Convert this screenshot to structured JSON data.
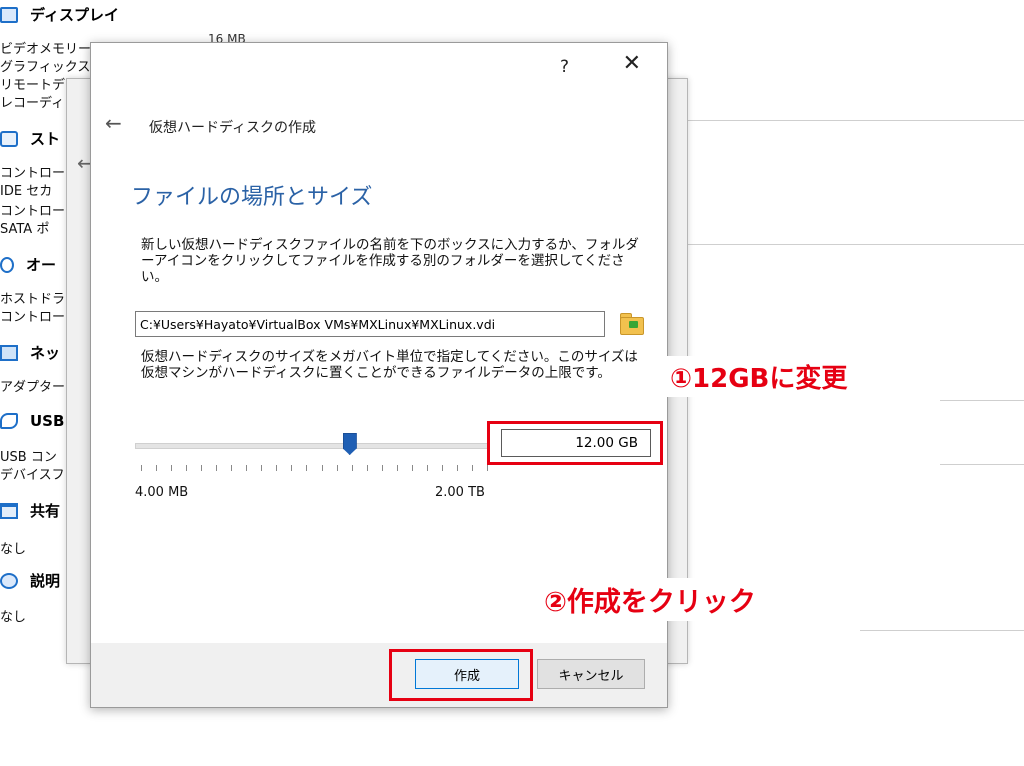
{
  "background": {
    "display_header": "ディスプレイ",
    "display_rows": [
      "ビデオメモリー",
      "グラフィックスコ",
      "リモートデスク",
      "レコーディ"
    ],
    "display_value": "16 MB",
    "storage_header": "スト",
    "storage_rows": [
      "コントロー",
      " IDE セカ",
      "コントロー",
      " SATA ポ"
    ],
    "audio_header": "オー",
    "audio_rows": [
      "ホストドラ",
      "コントロー"
    ],
    "network_header": "ネッ",
    "network_rows": [
      "アダプター"
    ],
    "usb_header": "USB",
    "usb_rows": [
      "USB コン",
      "デバイスフ"
    ],
    "shared_header": "共有",
    "shared_rows": [
      "なし"
    ],
    "description_header": "説明",
    "description_rows": [
      "なし"
    ]
  },
  "dialog": {
    "help_label": "?",
    "close_label": "✕",
    "back_label": "←",
    "wizard_title": "仮想ハードディスクの作成",
    "section_title": "ファイルの場所とサイズ",
    "location_description": "新しい仮想ハードディスクファイルの名前を下のボックスに入力するか、フォルダーアイコンをクリックしてファイルを作成する別のフォルダーを選択してください。",
    "file_path": "C:¥Users¥Hayato¥VirtualBox VMs¥MXLinux¥MXLinux.vdi",
    "size_description": "仮想ハードディスクのサイズをメガバイト単位で指定してください。このサイズは仮想マシンがハードディスクに置くことができるファイルデータの上限です。",
    "size_value": "12.00 GB",
    "slider_position": 0.61,
    "slider_min_label": "4.00 MB",
    "slider_max_label": "2.00 TB",
    "create_label": "作成",
    "cancel_label": "キャンセル"
  },
  "annotations": {
    "step1": "①12GBに変更",
    "step2": "②作成をクリック",
    "highlight_color": "#e60012"
  },
  "colors": {
    "section_title": "#2b62a6",
    "slider_thumb": "#1f5fb4",
    "primary_button_border": "#0078d7"
  },
  "icons": {
    "folder_button": "folder-open-icon",
    "display": "monitor-icon",
    "storage": "disk-icon",
    "audio": "speaker-icon",
    "network": "network-icon",
    "usb": "usb-icon",
    "shared": "folder-icon",
    "description": "description-icon"
  }
}
